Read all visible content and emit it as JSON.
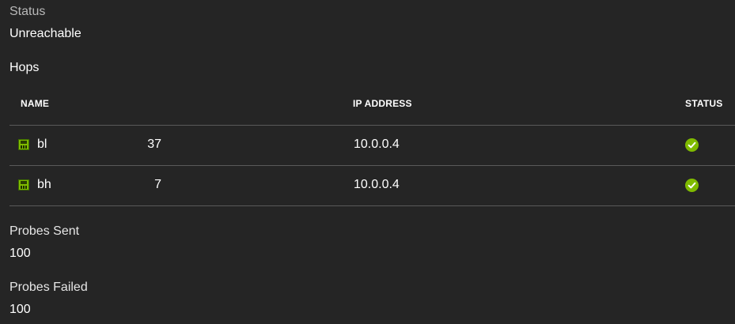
{
  "status": {
    "label": "Status",
    "value": "Unreachable"
  },
  "hops": {
    "heading": "Hops",
    "columns": {
      "name": "NAME",
      "ip_address": "IP ADDRESS",
      "status": "STATUS"
    },
    "rows": [
      {
        "name": "bl",
        "count": "37",
        "ip": "10.0.0.4",
        "icon": "vm-icon",
        "status_icon": "check-circle-icon",
        "status_color": "#7fba00"
      },
      {
        "name": "bh",
        "count": "7",
        "ip": "10.0.0.4",
        "icon": "vm-icon",
        "status_icon": "check-circle-icon",
        "status_color": "#7fba00"
      }
    ]
  },
  "probes_sent": {
    "label": "Probes Sent",
    "value": "100"
  },
  "probes_failed": {
    "label": "Probes Failed",
    "value": "100"
  },
  "colors": {
    "background": "#252525",
    "label": "#b8b8b8",
    "text": "#ffffff",
    "divider": "#5a5a5a",
    "success": "#7fba00"
  }
}
